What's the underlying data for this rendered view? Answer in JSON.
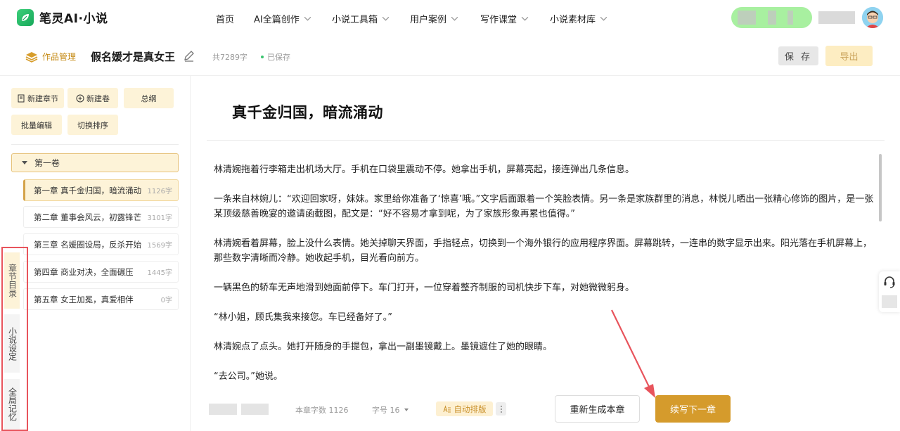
{
  "brand": {
    "name": "笔灵AI·小说"
  },
  "nav": [
    {
      "label": "首页",
      "dropdown": false
    },
    {
      "label": "AI全篇创作",
      "dropdown": true
    },
    {
      "label": "小说工具箱",
      "dropdown": true
    },
    {
      "label": "用户案例",
      "dropdown": true
    },
    {
      "label": "写作课堂",
      "dropdown": true
    },
    {
      "label": "小说素材库",
      "dropdown": true
    }
  ],
  "header": {
    "works_label": "作品管理",
    "book_title": "假名媛才是真女王",
    "word_count": "共7289字",
    "save_status": "已保存",
    "save_label": "保 存",
    "export_label": "导出"
  },
  "sidebar": {
    "buttons": {
      "new_chapter": "新建章节",
      "new_volume": "新建卷",
      "outline": "总纲",
      "batch_edit": "批量编辑",
      "switch_sort": "切换排序"
    },
    "volume": "第一卷",
    "chapters": [
      {
        "title": "第一章 真千金归国，暗流涌动",
        "count": "1126字",
        "active": true
      },
      {
        "title": "第二章 董事会风云，初露锋芒",
        "count": "3101字",
        "active": false
      },
      {
        "title": "第三章 名媛圈设局，反杀开始",
        "count": "1569字",
        "active": false
      },
      {
        "title": "第四章 商业对决，全面碾压",
        "count": "1445字",
        "active": false
      },
      {
        "title": "第五章 女王加冕，真爱相伴",
        "count": "0字",
        "active": false
      }
    ],
    "vertical_tabs": [
      {
        "label": "章节目录",
        "active": true
      },
      {
        "label": "小说设定",
        "active": false
      },
      {
        "label": "全局记忆",
        "active": false
      }
    ]
  },
  "editor": {
    "chapter_title": "真千金归国，暗流涌动",
    "paragraphs": [
      "林清婉拖着行李箱走出机场大厅。手机在口袋里震动不停。她拿出手机，屏幕亮起，接连弹出几条信息。",
      "一条来自林婉儿：“欢迎回家呀，妹妹。家里给你准备了‘惊喜’哦。”文字后面跟着一个笑脸表情。另一条是家族群里的消息，林悦儿晒出一张精心修饰的图片，是一张某顶级慈善晚宴的邀请函截图，配文是：“好不容易才拿到呢，为了家族形象再累也值得。”",
      "林清婉看着屏幕，脸上没什么表情。她关掉聊天界面，手指轻点，切换到一个海外银行的应用程序界面。屏幕跳转，一连串的数字显示出来。阳光落在手机屏幕上，那些数字清晰而冷静。她收起手机，目光看向前方。",
      "一辆黑色的轿车无声地滑到她面前停下。车门打开，一位穿着整齐制服的司机快步下车，对她微微躬身。",
      "“林小姐，顾氏集我来接您。车已经备好了。”",
      "林清婉点了点头。她打开随身的手提包，拿出一副墨镜戴上。墨镜遮住了她的眼睛。",
      "“去公司。”她说。"
    ]
  },
  "footer": {
    "chapter_word_count": "本章字数 1126",
    "font_size": "字号 16",
    "auto_format": "自动排版",
    "regenerate_label": "重新生成本章",
    "continue_label": "续写下一章"
  },
  "colors": {
    "accent": "#d59b2c",
    "accent_light": "#fdf3d8",
    "annotation_red": "#e8545c",
    "brand_green": "#17a85a"
  }
}
